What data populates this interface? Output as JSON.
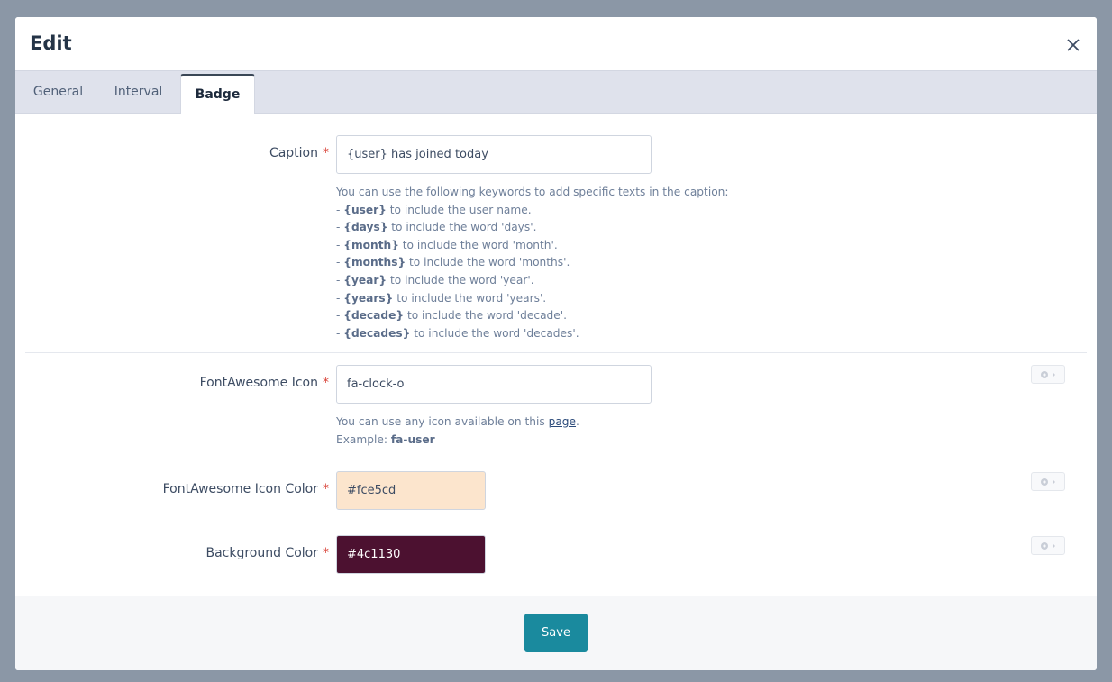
{
  "dialog": {
    "title": "Edit"
  },
  "tabs": [
    {
      "label": "General"
    },
    {
      "label": "Interval"
    },
    {
      "label": "Badge"
    }
  ],
  "fields": {
    "caption": {
      "label": "Caption",
      "required_mark": "*",
      "value": "{user} has joined today",
      "help_intro": "You can use the following keywords to add specific texts in the caption:",
      "keywords": [
        {
          "prefix": "- ",
          "key": "{user}",
          "text": " to include the user name."
        },
        {
          "prefix": "- ",
          "key": "{days}",
          "text": " to include the word 'days'."
        },
        {
          "prefix": "- ",
          "key": "{month}",
          "text": " to include the word 'month'."
        },
        {
          "prefix": "- ",
          "key": "{months}",
          "text": " to include the word 'months'."
        },
        {
          "prefix": "- ",
          "key": "{year}",
          "text": " to include the word 'year'."
        },
        {
          "prefix": "- ",
          "key": "{years}",
          "text": " to include the word 'years'."
        },
        {
          "prefix": "- ",
          "key": "{decade}",
          "text": " to include the word 'decade'."
        },
        {
          "prefix": "- ",
          "key": "{decades}",
          "text": " to include the word 'decades'."
        }
      ]
    },
    "icon": {
      "label": "FontAwesome Icon",
      "required_mark": "*",
      "value": "fa-clock-o",
      "help_text": "You can use any icon available on this ",
      "help_link": "page",
      "help_end": ".",
      "example_label": "Example: ",
      "example_value": "fa-user"
    },
    "icon_color": {
      "label": "FontAwesome Icon Color",
      "required_mark": "*",
      "value": "#fce5cd",
      "swatch": "#fce5cd",
      "text_color": "#3d4c63"
    },
    "background_color": {
      "label": "Background Color",
      "required_mark": "*",
      "value": "#4c1130",
      "swatch": "#4c1130",
      "text_color": "#ffffff"
    }
  },
  "footer": {
    "save_label": "Save"
  },
  "colors": {
    "primary_button": "#1a8a9e",
    "required": "#d9443a",
    "tabbar": "#dfe2ec"
  }
}
